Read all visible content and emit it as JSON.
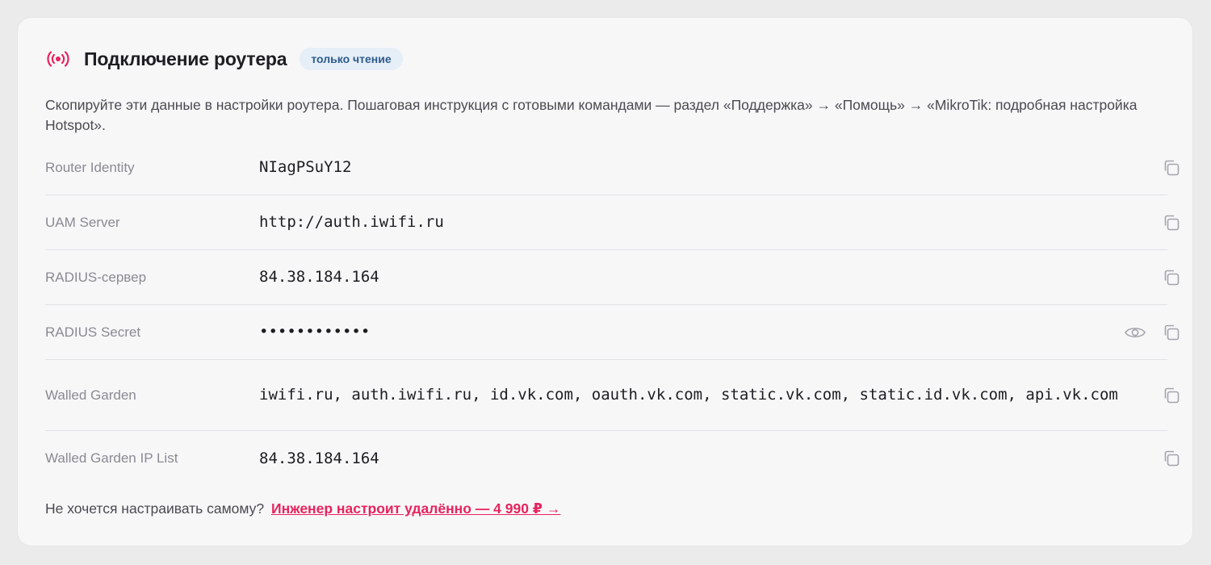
{
  "header": {
    "icon": "broadcast-icon",
    "title": "Подключение роутера",
    "badge": "только чтение",
    "accent_color": "#e8235d",
    "badge_bg": "#e6eef7",
    "badge_color": "#2d5b8c"
  },
  "description": "Скопируйте эти данные в настройки роутера. Пошаговая инструкция с готовыми командами — раздел «Поддержка» → «Помощь» → «MikroTik: подробная настройка Hotspot».",
  "rows": [
    {
      "label": "Router Identity",
      "value": "NIagPSuY12",
      "actions": [
        "copy-icon"
      ]
    },
    {
      "label": "UAM Server",
      "value": "http://auth.iwifi.ru",
      "actions": [
        "copy-icon"
      ]
    },
    {
      "label": "RADIUS-сервер",
      "value": "84.38.184.164",
      "actions": [
        "copy-icon"
      ]
    },
    {
      "label": "RADIUS Secret",
      "value": "••••••••••••",
      "actions": [
        "eye-icon",
        "copy-icon"
      ]
    },
    {
      "label": "Walled Garden",
      "value": "iwifi.ru, auth.iwifi.ru, id.vk.com, oauth.vk.com, static.vk.com, static.id.vk.com, api.vk.com",
      "actions": [
        "copy-icon"
      ]
    },
    {
      "label": "Walled Garden IP List",
      "value": "84.38.184.164",
      "actions": [
        "copy-icon"
      ]
    }
  ],
  "footer": {
    "text": "Не хочется настраивать самому?",
    "link": "Инженер настроит удалённо — 4 990 ₽ →"
  }
}
